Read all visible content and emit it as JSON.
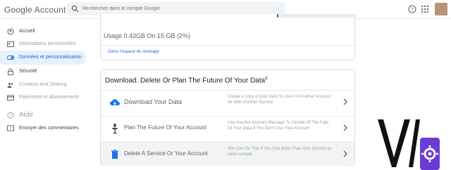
{
  "header": {
    "logo": "Google Account",
    "search_placeholder": "Rechercher dans le compte Google"
  },
  "sidebar": {
    "items": [
      {
        "label": "Accueil"
      },
      {
        "label": "Informations personnelles"
      },
      {
        "label": "Données et personnalisation"
      },
      {
        "label": "Sécurité"
      },
      {
        "label": "Contacts And Sharing"
      },
      {
        "label": "Paiements et abonnements"
      },
      {
        "label": "Aide"
      },
      {
        "label": "Envoyer des commentaires"
      }
    ]
  },
  "storage": {
    "usage_text": "Usage 0.43GB On 15 GB (2%)",
    "percent_used": 2,
    "manage_link": "Gérer l'espace de stockage"
  },
  "data_section": {
    "title": "Download. Delete Or Plan The Future Of Your Data",
    "title_suffix": "s",
    "rows": [
      {
        "name": "Download Your Data",
        "desc": "Create a copy of your data To use it in Another Account Or With Another Service"
      },
      {
        "name": "Plan The Future Of Your Account",
        "desc": "Use Inactive Account Manager To Decide Of The Fate Of Your Data If You Don't Use Your Account"
      },
      {
        "name": "Delete A Service Or Your Account",
        "desc": "You Can Do This If You Use More Than One Service ou votre compte"
      }
    ]
  },
  "colors": {
    "accent": "#1a73e8",
    "active_nav_bg": "#e8f0fe",
    "watermark_purple": "#6c3bd6"
  },
  "icons": [
    "search-icon",
    "help-icon",
    "apps-icon",
    "home-icon",
    "id-card-icon",
    "toggle-icon",
    "lock-icon",
    "people-icon",
    "card-icon",
    "help-circle-icon",
    "feedback-icon",
    "cloud-download-icon",
    "plan-icon",
    "trash-icon",
    "chevron-right-icon"
  ]
}
